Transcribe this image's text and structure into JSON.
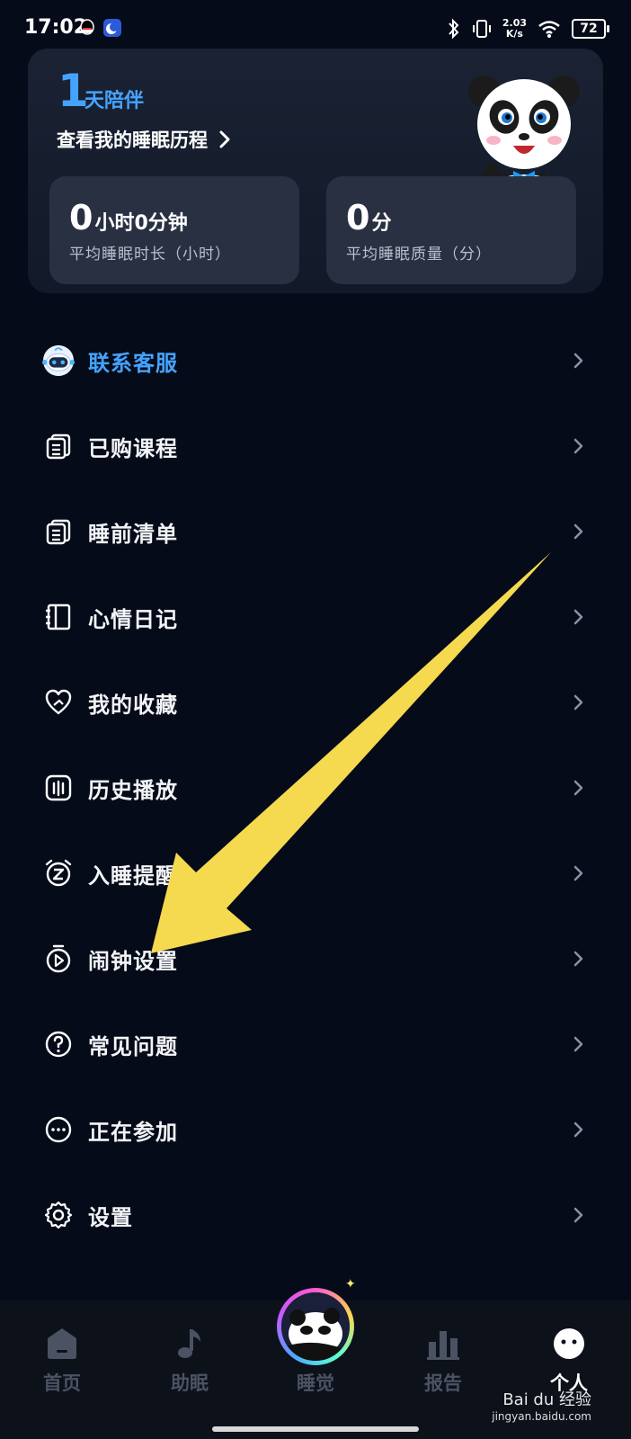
{
  "status_bar": {
    "time": "17:02",
    "net_speed_value": "2.03",
    "net_speed_unit": "K/s",
    "battery": "72"
  },
  "summary": {
    "days_count": "1",
    "days_label": "天陪伴",
    "history_link": "查看我的睡眠历程",
    "duration_hours": "0",
    "duration_rest": "小时0分钟",
    "duration_label": "平均睡眠时长（小时）",
    "quality_score": "0",
    "quality_unit": "分",
    "quality_label": "平均睡眠质量（分）"
  },
  "menu": {
    "items": [
      {
        "label": "联系客服",
        "icon": "robot-avatar-icon"
      },
      {
        "label": "已购课程",
        "icon": "document-stack-icon"
      },
      {
        "label": "睡前清单",
        "icon": "document-stack-icon"
      },
      {
        "label": "心情日记",
        "icon": "notebook-icon"
      },
      {
        "label": "我的收藏",
        "icon": "heart-icon"
      },
      {
        "label": "历史播放",
        "icon": "bars-icon"
      },
      {
        "label": "入睡提醒",
        "icon": "alarm-z-icon"
      },
      {
        "label": "闹钟设置",
        "icon": "stopwatch-play-icon"
      },
      {
        "label": "常见问题",
        "icon": "question-icon"
      },
      {
        "label": "正在参加",
        "icon": "ellipsis-icon"
      },
      {
        "label": "设置",
        "icon": "gear-icon"
      }
    ]
  },
  "bottom_nav": {
    "items": [
      {
        "label": "首页",
        "icon": "home-icon"
      },
      {
        "label": "助眠",
        "icon": "music-note-icon"
      },
      {
        "label": "睡觉",
        "icon": "panda-sleep-icon"
      },
      {
        "label": "报告",
        "icon": "bar-chart-icon"
      },
      {
        "label": "个人",
        "icon": "face-icon"
      }
    ],
    "active": "个人"
  },
  "watermark": {
    "text": "Bai du 经验",
    "sub": "jingyan.baidu.com"
  },
  "colors": {
    "background": "#050b18",
    "accent": "#45a3ff",
    "card": "#283042",
    "arrow": "#f5d94f"
  }
}
